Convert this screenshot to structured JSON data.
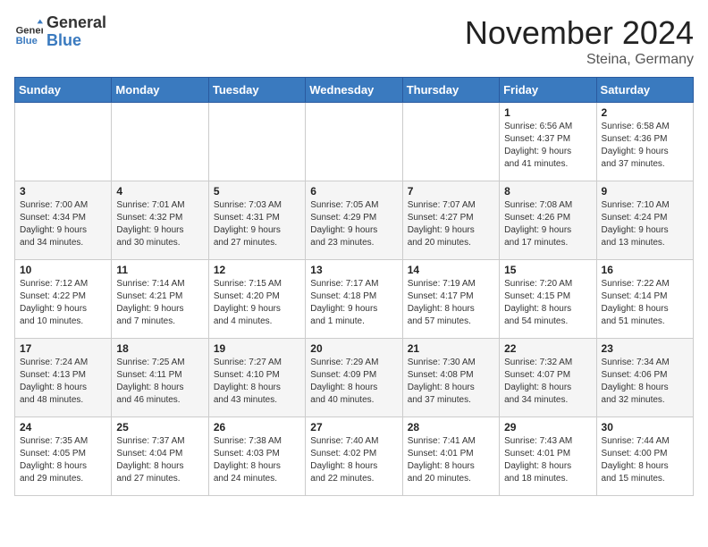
{
  "header": {
    "logo_line1": "General",
    "logo_line2": "Blue",
    "month": "November 2024",
    "location": "Steina, Germany"
  },
  "days_of_week": [
    "Sunday",
    "Monday",
    "Tuesday",
    "Wednesday",
    "Thursday",
    "Friday",
    "Saturday"
  ],
  "weeks": [
    [
      {
        "day": "",
        "info": ""
      },
      {
        "day": "",
        "info": ""
      },
      {
        "day": "",
        "info": ""
      },
      {
        "day": "",
        "info": ""
      },
      {
        "day": "",
        "info": ""
      },
      {
        "day": "1",
        "info": "Sunrise: 6:56 AM\nSunset: 4:37 PM\nDaylight: 9 hours\nand 41 minutes."
      },
      {
        "day": "2",
        "info": "Sunrise: 6:58 AM\nSunset: 4:36 PM\nDaylight: 9 hours\nand 37 minutes."
      }
    ],
    [
      {
        "day": "3",
        "info": "Sunrise: 7:00 AM\nSunset: 4:34 PM\nDaylight: 9 hours\nand 34 minutes."
      },
      {
        "day": "4",
        "info": "Sunrise: 7:01 AM\nSunset: 4:32 PM\nDaylight: 9 hours\nand 30 minutes."
      },
      {
        "day": "5",
        "info": "Sunrise: 7:03 AM\nSunset: 4:31 PM\nDaylight: 9 hours\nand 27 minutes."
      },
      {
        "day": "6",
        "info": "Sunrise: 7:05 AM\nSunset: 4:29 PM\nDaylight: 9 hours\nand 23 minutes."
      },
      {
        "day": "7",
        "info": "Sunrise: 7:07 AM\nSunset: 4:27 PM\nDaylight: 9 hours\nand 20 minutes."
      },
      {
        "day": "8",
        "info": "Sunrise: 7:08 AM\nSunset: 4:26 PM\nDaylight: 9 hours\nand 17 minutes."
      },
      {
        "day": "9",
        "info": "Sunrise: 7:10 AM\nSunset: 4:24 PM\nDaylight: 9 hours\nand 13 minutes."
      }
    ],
    [
      {
        "day": "10",
        "info": "Sunrise: 7:12 AM\nSunset: 4:22 PM\nDaylight: 9 hours\nand 10 minutes."
      },
      {
        "day": "11",
        "info": "Sunrise: 7:14 AM\nSunset: 4:21 PM\nDaylight: 9 hours\nand 7 minutes."
      },
      {
        "day": "12",
        "info": "Sunrise: 7:15 AM\nSunset: 4:20 PM\nDaylight: 9 hours\nand 4 minutes."
      },
      {
        "day": "13",
        "info": "Sunrise: 7:17 AM\nSunset: 4:18 PM\nDaylight: 9 hours\nand 1 minute."
      },
      {
        "day": "14",
        "info": "Sunrise: 7:19 AM\nSunset: 4:17 PM\nDaylight: 8 hours\nand 57 minutes."
      },
      {
        "day": "15",
        "info": "Sunrise: 7:20 AM\nSunset: 4:15 PM\nDaylight: 8 hours\nand 54 minutes."
      },
      {
        "day": "16",
        "info": "Sunrise: 7:22 AM\nSunset: 4:14 PM\nDaylight: 8 hours\nand 51 minutes."
      }
    ],
    [
      {
        "day": "17",
        "info": "Sunrise: 7:24 AM\nSunset: 4:13 PM\nDaylight: 8 hours\nand 48 minutes."
      },
      {
        "day": "18",
        "info": "Sunrise: 7:25 AM\nSunset: 4:11 PM\nDaylight: 8 hours\nand 46 minutes."
      },
      {
        "day": "19",
        "info": "Sunrise: 7:27 AM\nSunset: 4:10 PM\nDaylight: 8 hours\nand 43 minutes."
      },
      {
        "day": "20",
        "info": "Sunrise: 7:29 AM\nSunset: 4:09 PM\nDaylight: 8 hours\nand 40 minutes."
      },
      {
        "day": "21",
        "info": "Sunrise: 7:30 AM\nSunset: 4:08 PM\nDaylight: 8 hours\nand 37 minutes."
      },
      {
        "day": "22",
        "info": "Sunrise: 7:32 AM\nSunset: 4:07 PM\nDaylight: 8 hours\nand 34 minutes."
      },
      {
        "day": "23",
        "info": "Sunrise: 7:34 AM\nSunset: 4:06 PM\nDaylight: 8 hours\nand 32 minutes."
      }
    ],
    [
      {
        "day": "24",
        "info": "Sunrise: 7:35 AM\nSunset: 4:05 PM\nDaylight: 8 hours\nand 29 minutes."
      },
      {
        "day": "25",
        "info": "Sunrise: 7:37 AM\nSunset: 4:04 PM\nDaylight: 8 hours\nand 27 minutes."
      },
      {
        "day": "26",
        "info": "Sunrise: 7:38 AM\nSunset: 4:03 PM\nDaylight: 8 hours\nand 24 minutes."
      },
      {
        "day": "27",
        "info": "Sunrise: 7:40 AM\nSunset: 4:02 PM\nDaylight: 8 hours\nand 22 minutes."
      },
      {
        "day": "28",
        "info": "Sunrise: 7:41 AM\nSunset: 4:01 PM\nDaylight: 8 hours\nand 20 minutes."
      },
      {
        "day": "29",
        "info": "Sunrise: 7:43 AM\nSunset: 4:01 PM\nDaylight: 8 hours\nand 18 minutes."
      },
      {
        "day": "30",
        "info": "Sunrise: 7:44 AM\nSunset: 4:00 PM\nDaylight: 8 hours\nand 15 minutes."
      }
    ]
  ]
}
